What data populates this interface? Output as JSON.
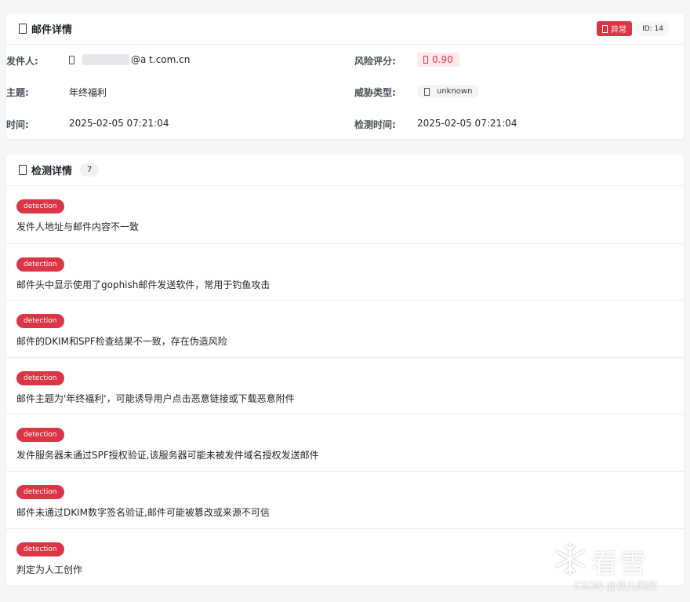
{
  "email_card": {
    "title": "邮件详情",
    "status_label": "异常",
    "id_label": "ID: 14",
    "sender_label": "发件人:",
    "sender_domain": "@a     t.com.cn",
    "subject_label": "主题:",
    "subject_value": "年终福利",
    "time_label": "时间:",
    "time_value": "2025-02-05 07:21:04",
    "risk_label": "风险评分:",
    "risk_value": "0.90",
    "threat_label": "威胁类型:",
    "threat_value": "unknown",
    "detect_time_label": "检测时间:",
    "detect_time_value": "2025-02-05 07:21:04"
  },
  "detection_card": {
    "title": "检测详情",
    "count": "7",
    "items": [
      {
        "tag": "detection",
        "text": "发件人地址与邮件内容不一致"
      },
      {
        "tag": "detection",
        "text": "邮件头中显示使用了gophish邮件发送软件，常用于钓鱼攻击"
      },
      {
        "tag": "detection",
        "text": "邮件的DKIM和SPF检查结果不一致，存在伪造风险"
      },
      {
        "tag": "detection",
        "text": "邮件主题为'年终福利'，可能诱导用户点击恶意链接或下载恶意附件"
      },
      {
        "tag": "detection",
        "text": "发件服务器未通过SPF授权验证,该服务器可能未被发件域名授权发送邮件"
      },
      {
        "tag": "detection",
        "text": "邮件未通过DKIM数字签名验证,邮件可能被篡改或来源不可信"
      },
      {
        "tag": "detection",
        "text": "判定为人工创作"
      }
    ]
  },
  "watermark": {
    "brand": "看雪",
    "csdn": "CSDN @安儿网安"
  },
  "colors": {
    "danger": "#dc3545",
    "background": "#f5f6f8"
  }
}
